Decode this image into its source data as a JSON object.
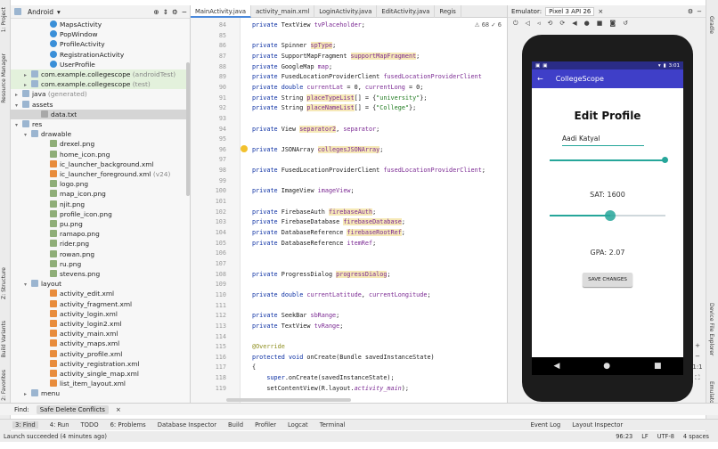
{
  "left_strip": {
    "tab_project": "1: Project",
    "tab_resource": "Resource Manager",
    "tab_structure": "Z: Structure",
    "tab_build_variants": "Build Variants",
    "tab_favorites": "2: Favorites"
  },
  "right_strip": {
    "tab_gradle": "Gradle",
    "tab_device_explorer": "Device File Explorer",
    "tab_emulator": "Emulator"
  },
  "project": {
    "view_selector": "Android",
    "tree": [
      {
        "label": "MapsActivity",
        "kind": "cls"
      },
      {
        "label": "PopWindow",
        "kind": "cls"
      },
      {
        "label": "ProfileActivity",
        "kind": "cls"
      },
      {
        "label": "RegistrationActivity",
        "kind": "cls"
      },
      {
        "label": "UserProfile",
        "kind": "cls"
      },
      {
        "label": "com.example.collegescope",
        "suffix": "(androidTest)",
        "kind": "fold"
      },
      {
        "label": "com.example.collegescope",
        "suffix": "(test)",
        "kind": "fold"
      },
      {
        "label": "java",
        "suffix": "(generated)",
        "kind": "fold"
      },
      {
        "label": "assets",
        "kind": "fold"
      },
      {
        "label": "data.txt",
        "kind": "txt"
      },
      {
        "label": "res",
        "kind": "fold"
      },
      {
        "label": "drawable",
        "kind": "fold"
      },
      {
        "label": "drexel.png",
        "kind": "img"
      },
      {
        "label": "home_icon.png",
        "kind": "img"
      },
      {
        "label": "ic_launcher_background.xml",
        "kind": "xml"
      },
      {
        "label": "ic_launcher_foreground.xml",
        "suffix": "(v24)",
        "kind": "xml"
      },
      {
        "label": "logo.png",
        "kind": "img"
      },
      {
        "label": "map_icon.png",
        "kind": "img"
      },
      {
        "label": "njit.png",
        "kind": "img"
      },
      {
        "label": "profile_icon.png",
        "kind": "img"
      },
      {
        "label": "pu.png",
        "kind": "img"
      },
      {
        "label": "ramapo.png",
        "kind": "img"
      },
      {
        "label": "rider.png",
        "kind": "img"
      },
      {
        "label": "rowan.png",
        "kind": "img"
      },
      {
        "label": "ru.png",
        "kind": "img"
      },
      {
        "label": "stevens.png",
        "kind": "img"
      },
      {
        "label": "layout",
        "kind": "fold"
      },
      {
        "label": "activity_edit.xml",
        "kind": "xml"
      },
      {
        "label": "activity_fragment.xml",
        "kind": "xml"
      },
      {
        "label": "activity_login.xml",
        "kind": "xml"
      },
      {
        "label": "activity_login2.xml",
        "kind": "xml"
      },
      {
        "label": "activity_main.xml",
        "kind": "xml"
      },
      {
        "label": "activity_maps.xml",
        "kind": "xml"
      },
      {
        "label": "activity_profile.xml",
        "kind": "xml"
      },
      {
        "label": "activity_registration.xml",
        "kind": "xml"
      },
      {
        "label": "activity_single_map.xml",
        "kind": "xml"
      },
      {
        "label": "list_item_layout.xml",
        "kind": "xml"
      },
      {
        "label": "menu",
        "kind": "fold"
      }
    ]
  },
  "editor": {
    "tabs": [
      "MainActivity.java",
      "activity_main.xml",
      "LoginActivity.java",
      "EditActivity.java",
      "Regis"
    ],
    "inspection": "⚠ 68  ✓ 6",
    "lines": [
      {
        "n": "84",
        "t": "private TextView tvPlaceholder;"
      },
      {
        "n": "85",
        "t": ""
      },
      {
        "n": "86",
        "t": "private Spinner spType;"
      },
      {
        "n": "87",
        "t": "private SupportMapFragment supportMapFragment;"
      },
      {
        "n": "88",
        "t": "private GoogleMap map;"
      },
      {
        "n": "89",
        "t": "private FusedLocationProviderClient fusedLocationProviderClient"
      },
      {
        "n": "90",
        "t": "private double currentLat = 0, currentLong = 0;"
      },
      {
        "n": "91",
        "t": "private String placeTypeList[] = {\"university\"};"
      },
      {
        "n": "92",
        "t": "private String placeNameList[] = {\"College\"};"
      },
      {
        "n": "93",
        "t": ""
      },
      {
        "n": "94",
        "t": "private View separator2, separator;"
      },
      {
        "n": "95",
        "t": ""
      },
      {
        "n": "96",
        "t": "private JSONArray collegesJSONArray;"
      },
      {
        "n": "97",
        "t": ""
      },
      {
        "n": "98",
        "t": "private FusedLocationProviderClient fusedLocationProviderClient;"
      },
      {
        "n": "99",
        "t": ""
      },
      {
        "n": "100",
        "t": "private ImageView imageView;"
      },
      {
        "n": "101",
        "t": ""
      },
      {
        "n": "102",
        "t": "private FirebaseAuth firebaseAuth;"
      },
      {
        "n": "103",
        "t": "private FirebaseDatabase firebaseDatabase;"
      },
      {
        "n": "104",
        "t": "private DatabaseReference firebaseRootRef;"
      },
      {
        "n": "105",
        "t": "private DatabaseReference itemRef;"
      },
      {
        "n": "106",
        "t": ""
      },
      {
        "n": "107",
        "t": ""
      },
      {
        "n": "108",
        "t": "private ProgressDialog progressDialog;"
      },
      {
        "n": "109",
        "t": ""
      },
      {
        "n": "110",
        "t": "private double currentLatitude, currentLongitude;"
      },
      {
        "n": "111",
        "t": ""
      },
      {
        "n": "112",
        "t": "private SeekBar sbRange;"
      },
      {
        "n": "113",
        "t": "private TextView tvRange;"
      },
      {
        "n": "114",
        "t": ""
      },
      {
        "n": "115",
        "t": "@Override"
      },
      {
        "n": "116",
        "t": "protected void onCreate(Bundle savedInstanceState)"
      },
      {
        "n": "117",
        "t": "{"
      },
      {
        "n": "118",
        "t": "    super.onCreate(savedInstanceState);"
      },
      {
        "n": "119",
        "t": "    setContentView(R.layout.activity_main);"
      }
    ]
  },
  "emulator": {
    "label": "Emulator:",
    "device": "Pixel 3 API 26",
    "status_time": "3:01",
    "app_title": "CollegeScope",
    "heading": "Edit Profile",
    "name_value": "Aadi Katyal",
    "sat_label": "SAT: 1600",
    "sat_value": 1600,
    "sat_fraction": 1.0,
    "gpa_label": "GPA: 2.07",
    "gpa_fraction": 0.52,
    "save_button": "SAVE CHANGES",
    "side_zoom": "1:1"
  },
  "bottom": {
    "find_label": "Find:",
    "find_tab": "Safe Delete Conflicts",
    "tool_windows": [
      "3: Find",
      "4: Run",
      "TODO",
      "6: Problems",
      "Database Inspector",
      "Build",
      "Profiler",
      "Logcat",
      "Terminal",
      "Event Log",
      "Layout Inspector"
    ],
    "status_text": "Launch succeeded (4 minutes ago)",
    "cursor_pos": "96:23",
    "line_sep": "LF",
    "encoding": "UTF-8",
    "indent": "4 spaces"
  },
  "colors": {
    "app_bar": "#3f3fc8",
    "status_bar": "#2a2c86",
    "accent": "#26a69a",
    "keyword": "#0b2fa3",
    "field": "#7b2a93"
  }
}
